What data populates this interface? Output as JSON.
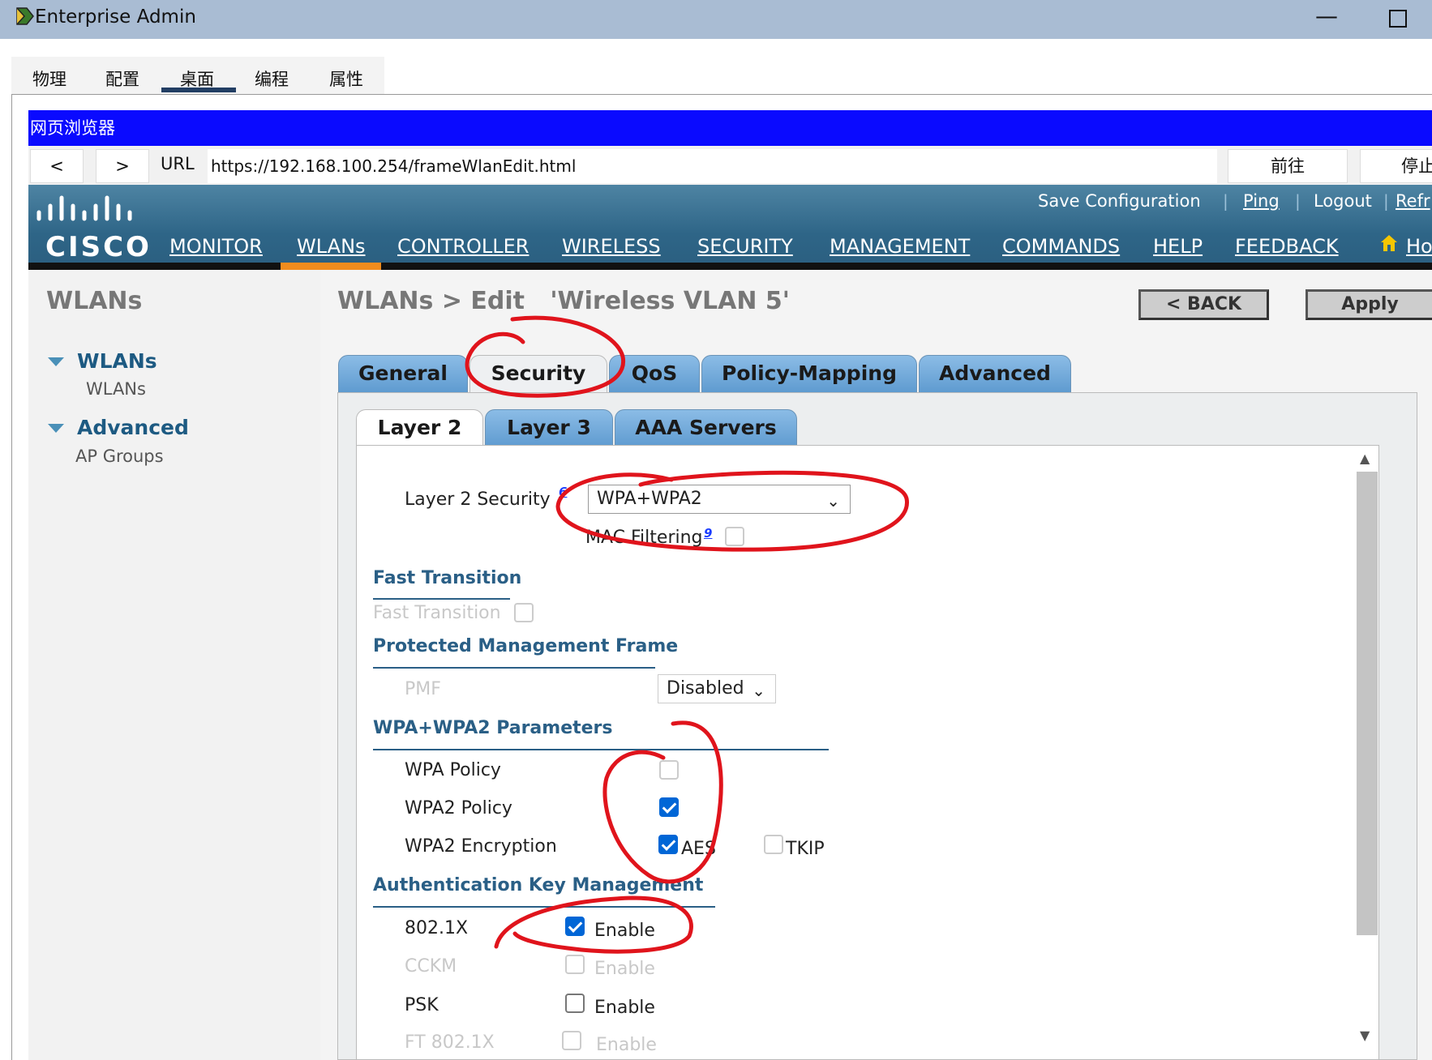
{
  "window": {
    "title": "Enterprise Admin"
  },
  "app_tabs": [
    "物理",
    "配置",
    "桌面",
    "编程",
    "属性"
  ],
  "browser": {
    "title": "网页浏览器",
    "back": "<",
    "forward": ">",
    "url_label": "URL",
    "url": "https://192.168.100.254/frameWlanEdit.html",
    "go": "前往",
    "stop": "停止"
  },
  "header": {
    "logo_text": "CISCO",
    "top_links": [
      "Save Configuration",
      "Ping",
      "Logout",
      "Refr"
    ],
    "separator": "|",
    "menu": [
      "MONITOR",
      "WLANs",
      "CONTROLLER",
      "WIRELESS",
      "SECURITY",
      "MANAGEMENT",
      "COMMANDS",
      "HELP",
      "FEEDBACK",
      "Ho"
    ],
    "active_menu": "WLANs"
  },
  "sidebar": {
    "title": "WLANs",
    "groups": [
      {
        "label": "WLANs",
        "items": [
          "WLANs"
        ]
      },
      {
        "label": "Advanced",
        "items": [
          "AP Groups"
        ]
      }
    ]
  },
  "page": {
    "title": "WLANs > Edit   'Wireless VLAN 5'",
    "back_button": "< BACK",
    "apply_button": "Apply",
    "tabs": [
      "General",
      "Security",
      "QoS",
      "Policy-Mapping",
      "Advanced"
    ],
    "active_tab": "Security",
    "subtabs": [
      "Layer 2",
      "Layer 3",
      "AAA Servers"
    ],
    "active_subtab": "Layer 2"
  },
  "form": {
    "layer2_security_label": "Layer 2 Security",
    "layer2_security_note": "6",
    "layer2_security_value": "WPA+WPA2",
    "mac_filtering_label": "MAC Filtering",
    "mac_filtering_note": "9",
    "mac_filtering_checked": false,
    "fast_transition_section": "Fast Transition",
    "fast_transition_label": "Fast Transition",
    "fast_transition_checked": false,
    "pmf_section": "Protected Management Frame",
    "pmf_label": "PMF",
    "pmf_value": "Disabled",
    "wpa_section": "WPA+WPA2 Parameters",
    "wpa_policy_label": "WPA Policy",
    "wpa_policy_checked": false,
    "wpa2_policy_label": "WPA2 Policy",
    "wpa2_policy_checked": true,
    "wpa2_encryption_label": "WPA2 Encryption",
    "aes_label": "AES",
    "aes_checked": true,
    "tkip_label": "TKIP",
    "tkip_checked": false,
    "akm_section": "Authentication Key Management",
    "akm_rows": [
      {
        "label": "802.1X",
        "option": "Enable",
        "checked": true,
        "disabled": false
      },
      {
        "label": "CCKM",
        "option": "Enable",
        "checked": false,
        "disabled": true
      },
      {
        "label": "PSK",
        "option": "Enable",
        "checked": false,
        "disabled": false
      },
      {
        "label": "FT 802.1X",
        "option": "Enable",
        "checked": false,
        "disabled": true
      }
    ]
  },
  "colors": {
    "browser_title_bg": "#0a0aff",
    "cisco_header_bg": "#2e6587",
    "active_menu_bar": "#f08c1e",
    "section_text": "#2a5f86",
    "checkbox_checked": "#0066d6",
    "annotation_red": "#e0141c"
  }
}
